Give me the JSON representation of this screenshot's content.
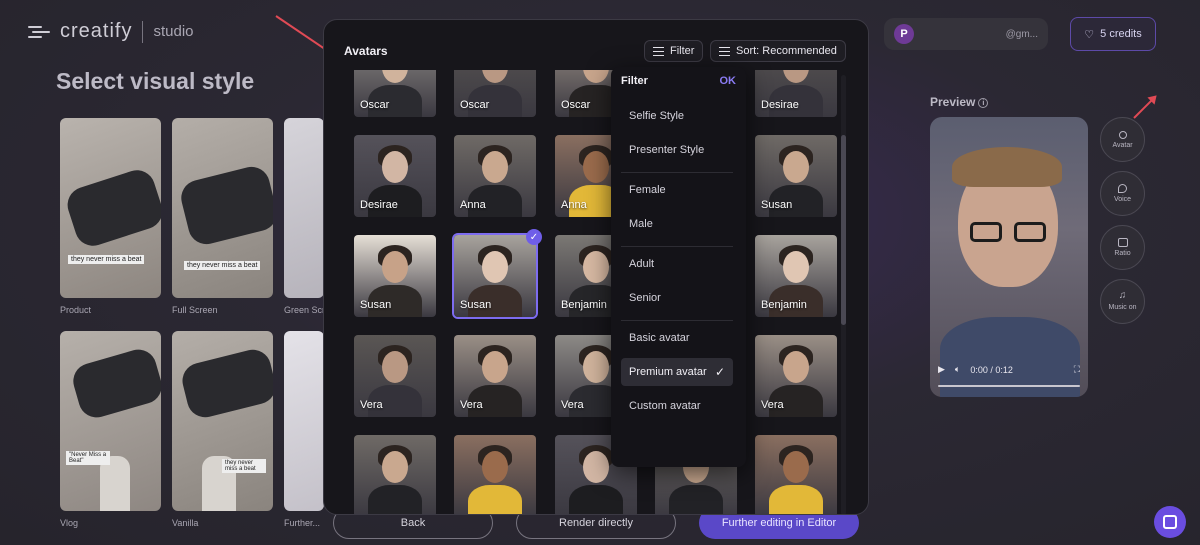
{
  "brand": {
    "name": "creatify",
    "sub": "studio"
  },
  "page_title": "Select visual style",
  "user": {
    "initial": "P",
    "email": "@gm..."
  },
  "credits": {
    "label": "5 credits"
  },
  "styles": [
    {
      "label": "Product",
      "caption": "they never miss a beat"
    },
    {
      "label": "Full Screen",
      "caption": "they never miss a beat"
    },
    {
      "label": "Green Scr..."
    },
    {
      "label": "Vlog",
      "caption": "\"Never Miss a Beat\""
    },
    {
      "label": "Vanilla",
      "caption": "they never miss a beat"
    },
    {
      "label": "Further..."
    }
  ],
  "preview": {
    "title": "Preview",
    "time": "0:00 / 0:12"
  },
  "side_tools": [
    {
      "label": "Avatar",
      "icon": "person-icon"
    },
    {
      "label": "Voice",
      "icon": "voice-icon"
    },
    {
      "label": "Ratio",
      "icon": "ratio-icon"
    },
    {
      "label": "Music on",
      "icon": "music-icon"
    }
  ],
  "bottom": {
    "back": "Back",
    "render": "Render directly",
    "further": "Further editing in Editor"
  },
  "modal": {
    "title": "Avatars",
    "filter_label": "Filter",
    "sort_label": "Sort: Recommended"
  },
  "avatars": [
    {
      "name": "Oscar"
    },
    {
      "name": "Oscar"
    },
    {
      "name": "Oscar"
    },
    {
      "name": ""
    },
    {
      "name": "Desirae"
    },
    {
      "name": "Desirae"
    },
    {
      "name": "Anna"
    },
    {
      "name": "Anna"
    },
    {
      "name": ""
    },
    {
      "name": "Susan"
    },
    {
      "name": "Susan"
    },
    {
      "name": "Susan",
      "selected": true
    },
    {
      "name": "Benjamin"
    },
    {
      "name": ""
    },
    {
      "name": "Benjamin"
    },
    {
      "name": "Vera"
    },
    {
      "name": "Vera"
    },
    {
      "name": "Vera"
    },
    {
      "name": ""
    },
    {
      "name": "Vera"
    },
    {
      "name": ""
    },
    {
      "name": ""
    },
    {
      "name": ""
    },
    {
      "name": ""
    },
    {
      "name": ""
    }
  ],
  "filter_panel": {
    "title": "Filter",
    "ok": "OK",
    "groups": [
      [
        "Selfie Style",
        "Presenter Style"
      ],
      [
        "Female",
        "Male"
      ],
      [
        "Adult",
        "Senior"
      ],
      [
        "Basic avatar",
        "Premium avatar",
        "Custom avatar"
      ]
    ],
    "selected": "Premium avatar"
  },
  "colors": {
    "accent": "#6f5ee8",
    "annotation_arrow": "#e04a55"
  }
}
